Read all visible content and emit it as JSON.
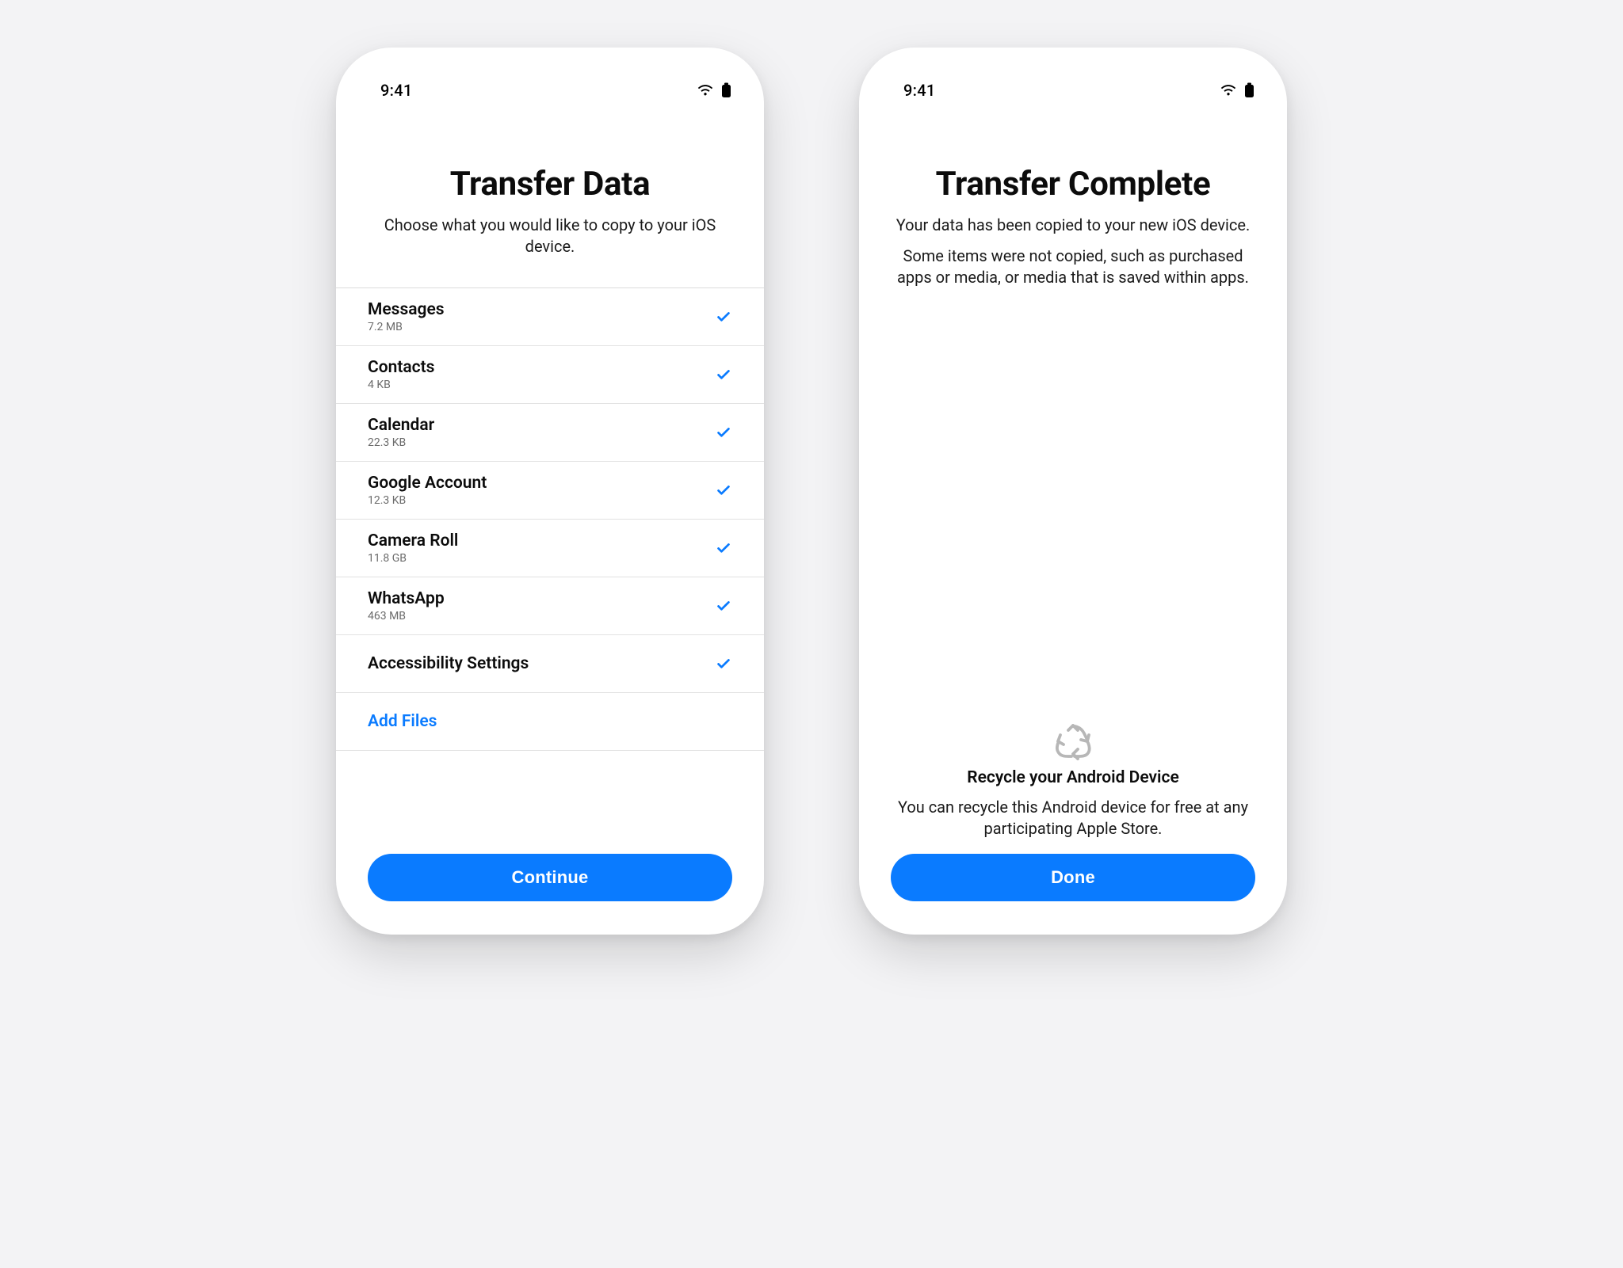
{
  "status": {
    "time": "9:41"
  },
  "accent": "#0a7bff",
  "left": {
    "title": "Transfer Data",
    "subtitle": "Choose what you would like to copy to your iOS device.",
    "items": [
      {
        "title": "Messages",
        "size": "7.2 MB"
      },
      {
        "title": "Contacts",
        "size": "4 KB"
      },
      {
        "title": "Calendar",
        "size": "22.3 KB"
      },
      {
        "title": "Google Account",
        "size": "12.3 KB"
      },
      {
        "title": "Camera Roll",
        "size": "11.8 GB"
      },
      {
        "title": "WhatsApp",
        "size": "463 MB"
      },
      {
        "title": "Accessibility Settings",
        "size": ""
      }
    ],
    "add_files": "Add Files",
    "cta": "Continue"
  },
  "right": {
    "title": "Transfer Complete",
    "subtitle": "Your data has been copied to your new iOS device.",
    "extra": "Some items were not copied, such as purchased apps or media, or media that is saved within apps.",
    "recycle_title": "Recycle your Android Device",
    "recycle_text": "You can recycle this Android device for free at any participating Apple Store.",
    "cta": "Done"
  }
}
